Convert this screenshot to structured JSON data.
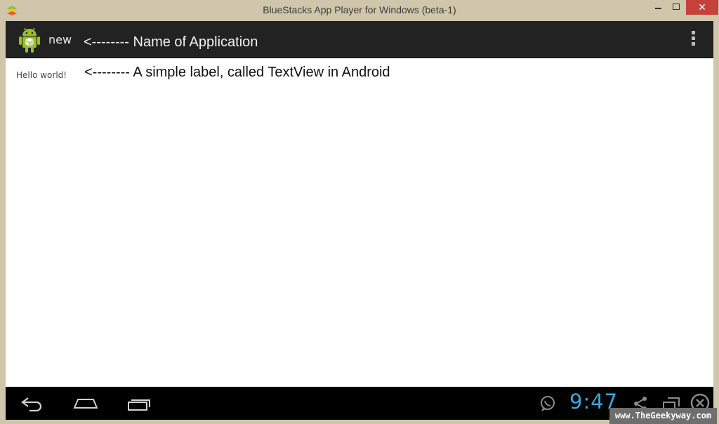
{
  "window": {
    "title": "BlueStacks App Player for Windows (beta-1)",
    "close_glyph": "✕"
  },
  "actionbar": {
    "app_name": "new",
    "annotation": "<-------- Name of Application",
    "icon": "android-robot-icon"
  },
  "content": {
    "textview": "Hello world!",
    "annotation": "<-------- A simple label, called TextView in Android"
  },
  "navbar": {
    "clock": "9:47",
    "icons": [
      "back-icon",
      "home-icon",
      "recent-apps-icon",
      "whatsapp-icon",
      "share-icon",
      "screen-icon",
      "close-circle-icon"
    ]
  },
  "watermark": "www.TheGeekyway.com",
  "colors": {
    "titlebar": "#cfc6ab",
    "actionbar": "#222222",
    "navbar": "#000000",
    "clock": "#3aa7d8",
    "close_button": "#c7413c"
  }
}
